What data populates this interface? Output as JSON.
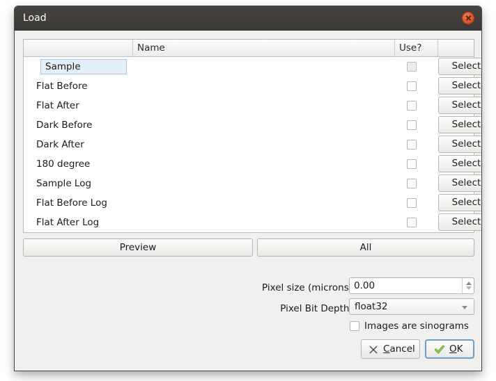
{
  "window": {
    "title": "Load",
    "close_icon": "close-icon"
  },
  "table": {
    "headers": {
      "blank": "",
      "name": "Name",
      "use": "Use?",
      "action": ""
    },
    "rows": [
      {
        "label": "Sample",
        "name": "",
        "checked": false,
        "checkbox_shaded": true,
        "selected": true,
        "action": "Select"
      },
      {
        "label": "Flat Before",
        "name": "",
        "checked": false,
        "checkbox_shaded": false,
        "selected": false,
        "action": "Select"
      },
      {
        "label": "Flat After",
        "name": "",
        "checked": false,
        "checkbox_shaded": false,
        "selected": false,
        "action": "Select"
      },
      {
        "label": "Dark Before",
        "name": "",
        "checked": false,
        "checkbox_shaded": false,
        "selected": false,
        "action": "Select"
      },
      {
        "label": "Dark After",
        "name": "",
        "checked": false,
        "checkbox_shaded": false,
        "selected": false,
        "action": "Select"
      },
      {
        "label": "180 degree",
        "name": "",
        "checked": false,
        "checkbox_shaded": false,
        "selected": false,
        "action": "Select"
      },
      {
        "label": "Sample Log",
        "name": "",
        "checked": false,
        "checkbox_shaded": false,
        "selected": false,
        "action": "Select"
      },
      {
        "label": "Flat Before Log",
        "name": "",
        "checked": false,
        "checkbox_shaded": false,
        "selected": false,
        "action": "Select"
      },
      {
        "label": "Flat After Log",
        "name": "",
        "checked": false,
        "checkbox_shaded": false,
        "selected": false,
        "action": "Select"
      }
    ]
  },
  "actions": {
    "preview_label": "Preview",
    "all_label": "All"
  },
  "form": {
    "pixel_size_label": "Pixel size (microns)",
    "pixel_size_value": "0.00",
    "bit_depth_label": "Pixel Bit Depth:",
    "bit_depth_value": "float32",
    "bit_depth_options": [
      "float32"
    ],
    "sinogram_label": "Images are sinograms",
    "sinogram_checked": false
  },
  "dialog_buttons": {
    "cancel_pre": "",
    "cancel_mnemonic": "C",
    "cancel_post": "ancel",
    "cancel_icon": "x-mark-icon",
    "ok_mnemonic": "O",
    "ok_post": "K",
    "ok_icon": "check-mark-icon"
  },
  "colors": {
    "titlebar": "#403d3a",
    "close_button": "#e2562a",
    "selection": "#e4eff7",
    "focus_ring": "#6b9ec9",
    "ok_check": "#8cc63f"
  }
}
